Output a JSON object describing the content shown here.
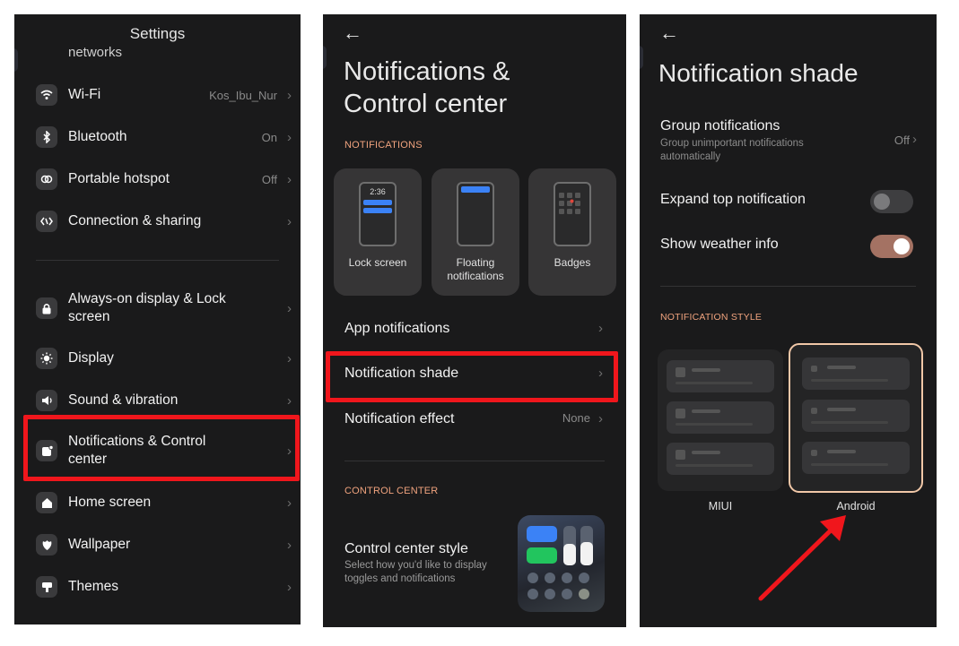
{
  "colors": {
    "highlight": "#f0161c",
    "accent": "#f0a37e",
    "toggle_on": "#a47263",
    "selected_border": "#f0c7a7"
  },
  "settings": {
    "title": "Settings",
    "cut_text": "networks",
    "items": [
      {
        "label": "Wi-Fi",
        "value": "Kos_Ibu_Nur",
        "icon": "wifi-icon"
      },
      {
        "label": "Bluetooth",
        "value": "On",
        "icon": "bluetooth-icon"
      },
      {
        "label": "Portable hotspot",
        "value": "Off",
        "icon": "hotspot-icon"
      },
      {
        "label": "Connection & sharing",
        "value": "",
        "icon": "connection-sharing-icon"
      },
      {
        "label": "Always-on display & Lock screen",
        "value": "",
        "icon": "lock-icon"
      },
      {
        "label": "Display",
        "value": "",
        "icon": "display-brightness-icon"
      },
      {
        "label": "Sound & vibration",
        "value": "",
        "icon": "speaker-icon"
      },
      {
        "label": "Notifications & Control center",
        "value": "",
        "icon": "notifications-icon"
      },
      {
        "label": "Home screen",
        "value": "",
        "icon": "home-icon"
      },
      {
        "label": "Wallpaper",
        "value": "",
        "icon": "wallpaper-icon"
      },
      {
        "label": "Themes",
        "value": "",
        "icon": "themes-icon"
      }
    ]
  },
  "notif_center": {
    "back": "←",
    "title_line1": "Notifications &",
    "title_line2": "Control center",
    "notifications_header": "NOTIFICATIONS",
    "cards": [
      {
        "label": "Lock screen",
        "time": "2:36"
      },
      {
        "label": "Floating notifications"
      },
      {
        "label": "Badges"
      }
    ],
    "rows": [
      {
        "label": "App notifications",
        "value": ""
      },
      {
        "label": "Notification shade",
        "value": ""
      },
      {
        "label": "Notification effect",
        "value": "None"
      }
    ],
    "control_center_header": "CONTROL CENTER",
    "ccs_title": "Control center style",
    "ccs_sub": "Select how you'd like to display toggles and notifications"
  },
  "notif_shade": {
    "back": "←",
    "title": "Notification shade",
    "group_label": "Group notifications",
    "group_sub": "Group unimportant notifications automatically",
    "group_value": "Off",
    "expand_label": "Expand top notification",
    "expand_on": false,
    "weather_label": "Show weather info",
    "weather_on": true,
    "style_header": "NOTIFICATION STYLE",
    "style_options": [
      {
        "label": "MIUI",
        "selected": false
      },
      {
        "label": "Android",
        "selected": true
      }
    ]
  }
}
